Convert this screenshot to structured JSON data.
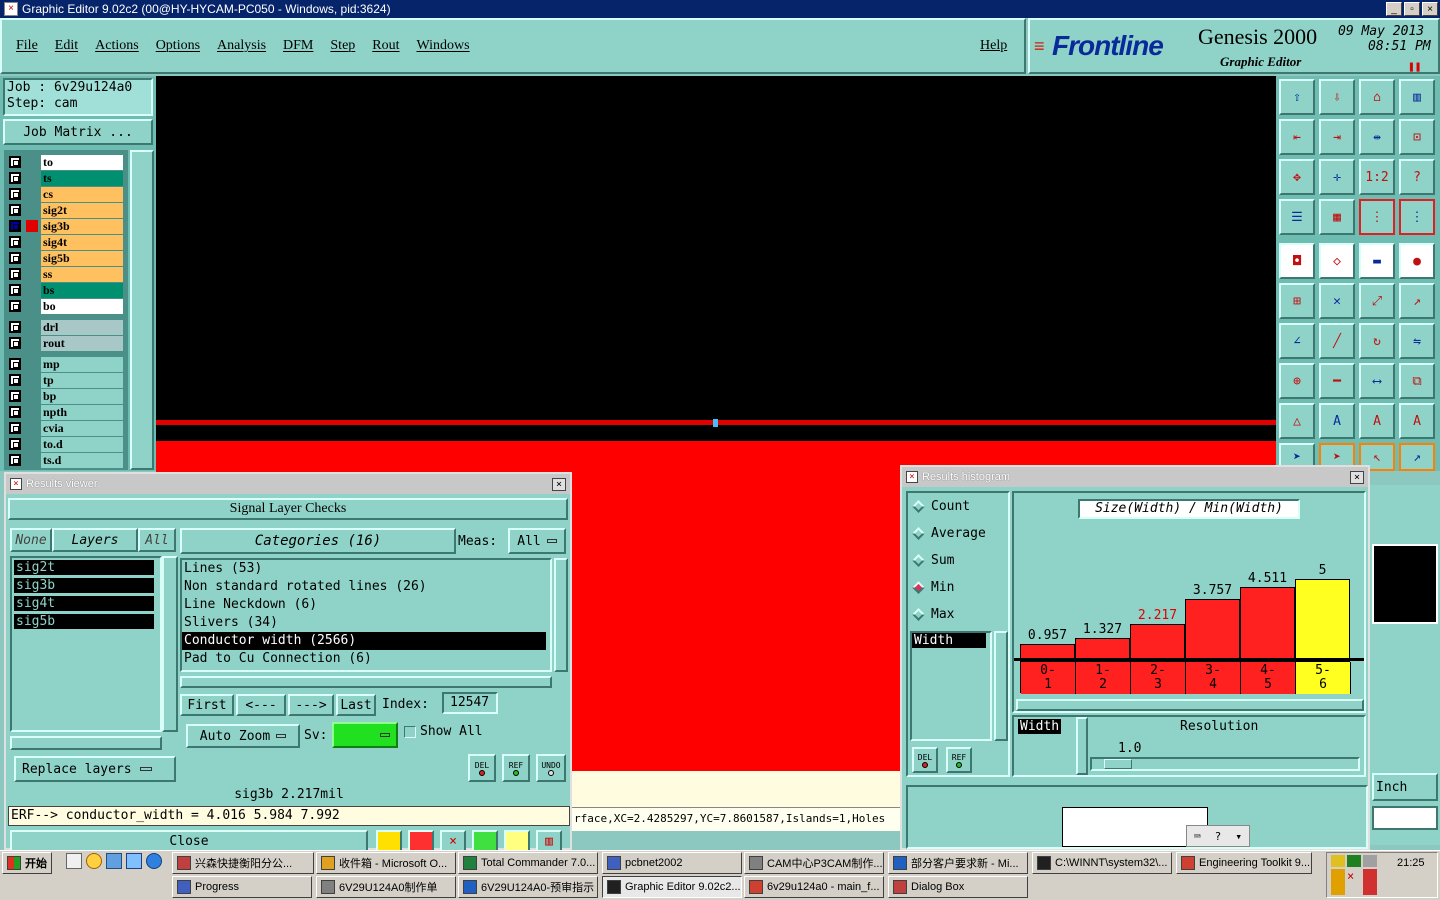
{
  "window": {
    "title": "Graphic Editor 9.02c2 (00@HY-HYCAM-PC050 - Windows, pid:3624)",
    "controls": [
      "_",
      "▫",
      "×"
    ]
  },
  "menu": [
    "File",
    "Edit",
    "Actions",
    "Options",
    "Analysis",
    "DFM",
    "Step",
    "Rout",
    "Windows"
  ],
  "help": "Help",
  "brand": {
    "logo": "Frontline",
    "product": "Genesis 2000",
    "subtitle": "Graphic Editor",
    "date": "09 May 2013",
    "time": "08:51 PM"
  },
  "job": {
    "job_label": "Job : 6v29u124a0",
    "step_label": "Step: cam",
    "matrix_button": "Job Matrix ..."
  },
  "layers_top": [
    {
      "name": "to",
      "color": "#ffffff"
    },
    {
      "name": "ts",
      "color": "#009070"
    },
    {
      "name": "cs",
      "color": "#ffc060"
    },
    {
      "name": "sig2t",
      "color": "#ffc060"
    },
    {
      "name": "sig3b",
      "color": "#ffc060"
    },
    {
      "name": "sig4t",
      "color": "#ffc060"
    },
    {
      "name": "sig5b",
      "color": "#ffc060"
    },
    {
      "name": "ss",
      "color": "#ffc060"
    },
    {
      "name": "bs",
      "color": "#009070"
    },
    {
      "name": "bo",
      "color": "#ffffff"
    }
  ],
  "layers_drill": [
    {
      "name": "drl",
      "color": "#a8c8c8"
    },
    {
      "name": "rout",
      "color": "#a8c8c8"
    }
  ],
  "layers_other": [
    {
      "name": "mp",
      "color": "#8fd3c8"
    },
    {
      "name": "tp",
      "color": "#8fd3c8"
    },
    {
      "name": "bp",
      "color": "#8fd3c8"
    },
    {
      "name": "npth",
      "color": "#8fd3c8"
    },
    {
      "name": "cvia",
      "color": "#8fd3c8"
    },
    {
      "name": "to.d",
      "color": "#8fd3c8"
    },
    {
      "name": "ts.d",
      "color": "#8fd3c8"
    }
  ],
  "results_viewer": {
    "title": "Results viewer",
    "header": "Signal Layer Checks",
    "none": "None",
    "layers": "Layers",
    "all": "All",
    "layer_list": [
      "sig2t",
      "sig3b",
      "sig4t",
      "sig5b"
    ],
    "categories_label": "Categories (16)",
    "meas_label": "Meas:",
    "meas_value": "All",
    "categories": [
      "Lines (53)",
      "Non standard rotated lines (26)",
      "Line Neckdown (6)",
      "Slivers (34)",
      "Conductor width (2566)",
      "Pad to Cu Connection (6)"
    ],
    "selected_category": "Conductor width (2566)",
    "nav": {
      "first": "First",
      "prev": "<---",
      "next": "--->",
      "last": "Last",
      "index_label": "Index:",
      "index_value": "12547"
    },
    "auto_zoom": "Auto Zoom",
    "sv_label": "Sv:",
    "show_all": "Show All",
    "replace_layers": "Replace layers",
    "small_buttons": [
      "DEL",
      "REF",
      "UNDO"
    ],
    "status1": "sig3b 2.217mil",
    "status2": "ERF--> conductor_width = 4.016 5.984 7.992",
    "close": "Close"
  },
  "status_line": "rface,XC=2.4285297,YC=7.8601587,Islands=1,Holes",
  "histogram": {
    "title": "Results histogram",
    "modes": [
      "Count",
      "Average",
      "Sum",
      "Min",
      "Max"
    ],
    "selected_mode": "Min",
    "field_list": [
      "Width"
    ],
    "buttons": [
      "DEL",
      "REF"
    ],
    "chart_title": "Size(Width) / Min(Width)",
    "resolution_label": "Resolution",
    "resolution_value": "1.0",
    "width_label": "Width",
    "inch_label": "Inch"
  },
  "chart_data": {
    "type": "bar",
    "title": "Size(Width) / Min(Width)",
    "categories": [
      "0-1",
      "1-2",
      "2-3",
      "3-4",
      "4-5",
      "5-6"
    ],
    "values": [
      0.957,
      1.327,
      2.217,
      3.757,
      4.511,
      5
    ],
    "value_labels": [
      "0.957",
      "1.327",
      "2.217",
      "3.757",
      "4.511",
      "5"
    ],
    "bar_colors": [
      "#ff2020",
      "#ff2020",
      "#ff2020",
      "#ff2020",
      "#ff2020",
      "#ffff20"
    ],
    "label_colors": [
      "#000000",
      "#000000",
      "#e00000",
      "#000000",
      "#000000",
      "#000000"
    ],
    "ylim": [
      0,
      5.5
    ]
  },
  "toolbar_tools": [
    "open-step",
    "save",
    "home",
    "panel",
    "zoom-prev",
    "zoom-next",
    "zoom-home",
    "window",
    "fit",
    "center",
    "one-to-one",
    "help",
    "settings",
    "grid",
    "snap",
    "snap-alt",
    "select",
    "copy",
    "measure",
    "pad",
    "net",
    "cross",
    "move",
    "rotate",
    "angle",
    "line",
    "arc",
    "flip",
    "pad-add",
    "minus",
    "scale",
    "group",
    "triangle",
    "tri-a",
    "tri-b",
    "tri-c",
    "arrow",
    "arrow-b",
    "cursor",
    "cursor-b"
  ],
  "taskbar": {
    "start": "开始",
    "row1": [
      "兴森快捷衡阳分公...",
      "收件箱 - Microsoft O...",
      "Total Commander 7.0...",
      "pcbnet2002",
      "CAM中心P3CAM制作...",
      "部分客户要求新 - Mi...",
      "C:\\WINNT\\system32\\...",
      "Engineering Toolkit 9...."
    ],
    "row2": [
      "Progress",
      "6V29U124A0制作单",
      "6V29U124A0-预审指示",
      "Graphic Editor 9.02c2...",
      "6v29u124a0 - main_f...",
      "Dialog Box"
    ],
    "clock": "21:25"
  }
}
